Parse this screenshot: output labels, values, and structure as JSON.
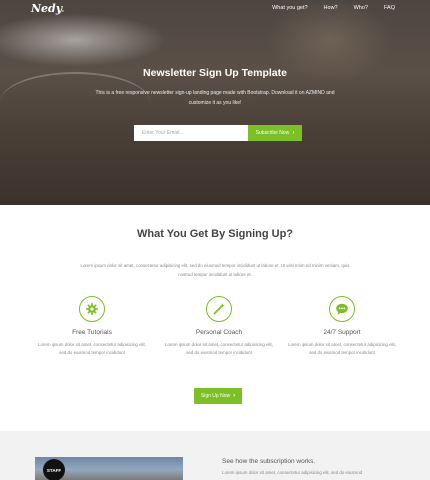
{
  "nav": {
    "logo": "Nedy",
    "logo_dot": ".",
    "links": [
      "What you get?",
      "How?",
      "Who?",
      "FAQ"
    ]
  },
  "hero": {
    "title": "Newsletter Sign Up Template",
    "subtitle": "This is a free responsive newsletter sign-up landing page made with Bootstrap. Download it on AZMIND and customize it as you like!",
    "email_placeholder": "Enter Your Email...",
    "subscribe_label": "Subscribe Now"
  },
  "features": {
    "title": "What You Get By Signing Up?",
    "intro": "Lorem ipsum dolor sit amet, consectetur adipisicing elit, sed do eiusmod tempor incididunt ut labore et. Ut wisi enim ad minim veniam, quis nostrud tempor incididunt ut labore et.",
    "items": [
      {
        "icon": "gear-icon",
        "title": "Free Tutorials",
        "desc": "Lorem ipsum dolor sit amet, consectetur adipisicing elit, sed do eiusmod tempor incididunt"
      },
      {
        "icon": "magic-wand-icon",
        "title": "Personal Coach",
        "desc": "Lorem ipsum dolor sit amet, consectetur adipisicing elit, sed do eiusmod tempor incididunt"
      },
      {
        "icon": "chat-bubble-icon",
        "title": "24/7 Support",
        "desc": "Lorem ipsum dolor sit amet, consectetur adipisicing elit, sed do eiusmod tempor incididunt"
      }
    ],
    "cta_label": "Sign Up Now"
  },
  "how": {
    "badge_text": "STAFF",
    "title": "See how the subscription works.",
    "text": "Lorem ipsum dolor sit amet, consectetur adipisicing elit, sed do eiusmod"
  },
  "colors": {
    "accent": "#7dbf27",
    "hero_bg": "#4d4540"
  }
}
